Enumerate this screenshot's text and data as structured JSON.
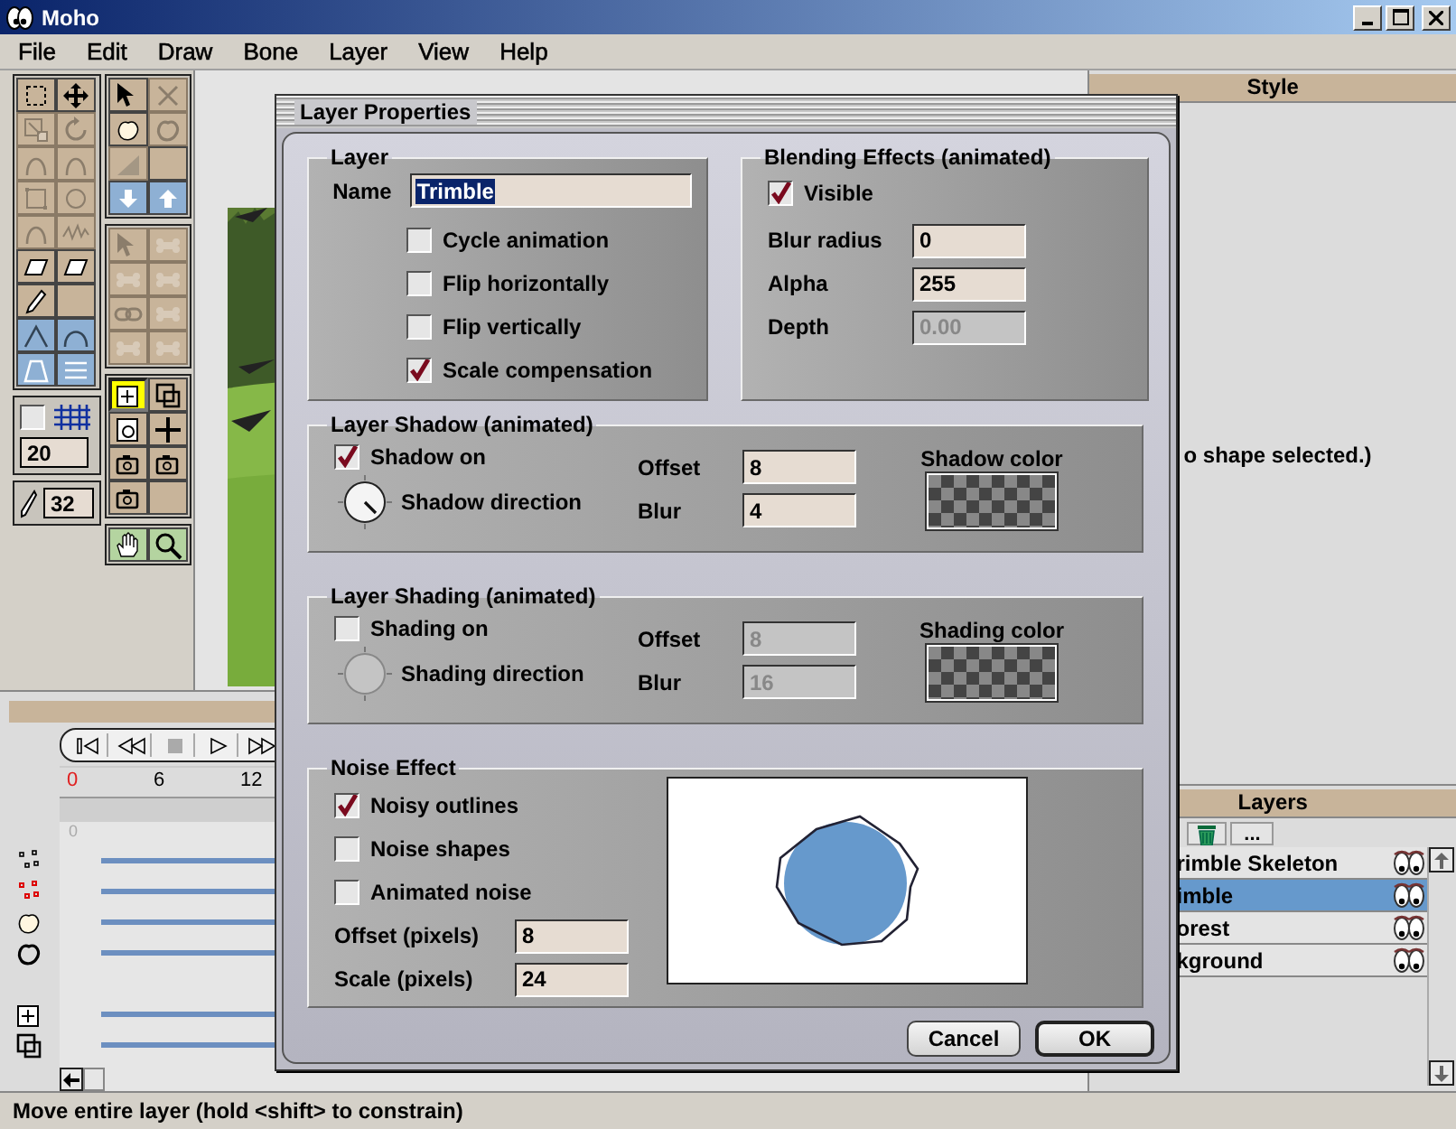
{
  "window": {
    "title": "Moho"
  },
  "menu": [
    "File",
    "Edit",
    "Draw",
    "Bone",
    "Layer",
    "View",
    "Help"
  ],
  "toolbox": {
    "left_tools": [
      {
        "kind": "marquee",
        "disabled": false,
        "selected": false,
        "color": "#c8b49a"
      },
      {
        "kind": "move",
        "disabled": false,
        "selected": false,
        "color": "#c8b49a"
      },
      {
        "kind": "scale",
        "disabled": true,
        "selected": false,
        "color": "#c8b49a"
      },
      {
        "kind": "rotate",
        "disabled": true,
        "selected": false,
        "color": "#c8b49a"
      },
      {
        "kind": "curve",
        "disabled": true,
        "selected": false,
        "color": "#c8b49a"
      },
      {
        "kind": "curve",
        "disabled": true,
        "selected": false,
        "color": "#c8b49a"
      },
      {
        "kind": "rect",
        "disabled": true,
        "selected": false,
        "color": "#c8b49a"
      },
      {
        "kind": "circle",
        "disabled": true,
        "selected": false,
        "color": "#c8b49a"
      },
      {
        "kind": "curve",
        "disabled": true,
        "selected": false,
        "color": "#c8b49a"
      },
      {
        "kind": "wave",
        "disabled": true,
        "selected": false,
        "color": "#c8b49a"
      },
      {
        "kind": "warp",
        "disabled": false,
        "selected": false,
        "color": "#c8b49a"
      },
      {
        "kind": "warp",
        "disabled": false,
        "selected": false,
        "color": "#c8b49a"
      },
      {
        "kind": "pencil",
        "disabled": false,
        "selected": false,
        "color": "#c8b49a"
      },
      {
        "kind": "blank",
        "disabled": false,
        "selected": false,
        "color": "#c8b49a"
      },
      {
        "kind": "peak",
        "disabled": false,
        "selected": false,
        "color": "#8eb0d4"
      },
      {
        "kind": "arch",
        "disabled": false,
        "selected": false,
        "color": "#8eb0d4"
      },
      {
        "kind": "trapezoid",
        "disabled": false,
        "selected": false,
        "color": "#8eb0d4"
      },
      {
        "kind": "lines",
        "disabled": false,
        "selected": false,
        "color": "#8eb0d4"
      }
    ],
    "grid": {
      "checked": false,
      "value": "20"
    },
    "brush": {
      "value": "32"
    },
    "right_groups": [
      {
        "tools": [
          {
            "kind": "pointer",
            "disabled": false,
            "selected": false,
            "color": "#c8b49a"
          },
          {
            "kind": "delete",
            "disabled": true,
            "selected": false,
            "color": "#c8b49a"
          },
          {
            "kind": "fill",
            "disabled": false,
            "selected": false,
            "color": "#c8b49a"
          },
          {
            "kind": "outline",
            "disabled": true,
            "selected": false,
            "color": "#c8b49a"
          },
          {
            "kind": "ramp",
            "disabled": true,
            "selected": false,
            "color": "#c8b49a"
          },
          {
            "kind": "blank",
            "disabled": false,
            "selected": false,
            "color": "#c8b49a"
          },
          {
            "kind": "down",
            "disabled": false,
            "selected": false,
            "color": "#8eb0d4"
          },
          {
            "kind": "up",
            "disabled": false,
            "selected": false,
            "color": "#8eb0d4"
          }
        ]
      },
      {
        "tools": [
          {
            "kind": "pointer",
            "disabled": true,
            "selected": false,
            "color": "#c8b49a"
          },
          {
            "kind": "bone",
            "disabled": true,
            "selected": false,
            "color": "#c8b49a"
          },
          {
            "kind": "bone",
            "disabled": true,
            "selected": false,
            "color": "#c8b49a"
          },
          {
            "kind": "bone",
            "disabled": true,
            "selected": false,
            "color": "#c8b49a"
          },
          {
            "kind": "chain",
            "disabled": true,
            "selected": false,
            "color": "#c8b49a"
          },
          {
            "kind": "bone",
            "disabled": true,
            "selected": false,
            "color": "#c8b49a"
          },
          {
            "kind": "bone",
            "disabled": true,
            "selected": false,
            "color": "#c8b49a"
          },
          {
            "kind": "bone",
            "disabled": true,
            "selected": false,
            "color": "#c8b49a"
          }
        ]
      },
      {
        "tools": [
          {
            "kind": "layermove",
            "disabled": false,
            "selected": true,
            "color": "#ffff00"
          },
          {
            "kind": "layerscale",
            "disabled": false,
            "selected": false,
            "color": "#c8b49a"
          },
          {
            "kind": "layerrotate",
            "disabled": false,
            "selected": false,
            "color": "#c8b49a"
          },
          {
            "kind": "plus",
            "disabled": false,
            "selected": false,
            "color": "#c8b49a"
          },
          {
            "kind": "camera",
            "disabled": false,
            "selected": false,
            "color": "#c8b49a"
          },
          {
            "kind": "camera",
            "disabled": false,
            "selected": false,
            "color": "#c8b49a"
          },
          {
            "kind": "camera",
            "disabled": false,
            "selected": false,
            "color": "#c8b49a"
          },
          {
            "kind": "blank",
            "disabled": false,
            "selected": false,
            "color": "#c8b49a"
          }
        ]
      },
      {
        "tools": [
          {
            "kind": "hand",
            "disabled": false,
            "selected": false,
            "color": "#b4d4a0"
          },
          {
            "kind": "zoom",
            "disabled": false,
            "selected": false,
            "color": "#b4d4a0"
          }
        ]
      }
    ]
  },
  "timeline": {
    "ruler": [
      {
        "label": "0",
        "current": true
      },
      {
        "label": "6",
        "current": false
      },
      {
        "label": "12",
        "current": false
      }
    ],
    "start_frame": "0",
    "channels": [
      {
        "kind": "points"
      },
      {
        "kind": "selection"
      },
      {
        "kind": "fill"
      },
      {
        "kind": "outline"
      },
      {
        "kind": "translation"
      },
      {
        "kind": "scale"
      }
    ]
  },
  "style_panel": {
    "title": "Style",
    "message": "o shape selected.)"
  },
  "layers_panel": {
    "title": "Layers",
    "more_button": "...",
    "layers": [
      {
        "name": "rimble Skeleton",
        "selected": false
      },
      {
        "name": "imble",
        "selected": true
      },
      {
        "name": "orest",
        "selected": false
      },
      {
        "name": "kground",
        "selected": false
      }
    ]
  },
  "status_bar": "Move entire layer (hold <shift> to constrain)",
  "dialog": {
    "title": "Layer Properties",
    "layer": {
      "title": "Layer",
      "name_label": "Name",
      "name_value": "Trimble",
      "name_selected": true,
      "options": [
        {
          "label": "Cycle animation",
          "checked": false
        },
        {
          "label": "Flip horizontally",
          "checked": false
        },
        {
          "label": "Flip vertically",
          "checked": false
        },
        {
          "label": "Scale compensation",
          "checked": true
        }
      ]
    },
    "blending": {
      "title": "Blending Effects (animated)",
      "visible": {
        "label": "Visible",
        "checked": true
      },
      "fields": [
        {
          "label": "Blur radius",
          "value": "0",
          "disabled": false
        },
        {
          "label": "Alpha",
          "value": "255",
          "disabled": false
        },
        {
          "label": "Depth",
          "value": "0.00",
          "disabled": true
        }
      ]
    },
    "shadow": {
      "title": "Layer Shadow (animated)",
      "toggle": {
        "label": "Shadow on",
        "checked": true
      },
      "direction": {
        "label": "Shadow direction",
        "disabled": false
      },
      "fields": [
        {
          "label": "Offset",
          "value": "8",
          "disabled": false
        },
        {
          "label": "Blur",
          "value": "4",
          "disabled": false
        }
      ],
      "color_label": "Shadow color"
    },
    "shading": {
      "title": "Layer Shading (animated)",
      "toggle": {
        "label": "Shading on",
        "checked": false
      },
      "direction": {
        "label": "Shading direction",
        "disabled": true
      },
      "fields": [
        {
          "label": "Offset",
          "value": "8",
          "disabled": true
        },
        {
          "label": "Blur",
          "value": "16",
          "disabled": true
        }
      ],
      "color_label": "Shading color"
    },
    "noise": {
      "title": "Noise Effect",
      "options": [
        {
          "label": "Noisy outlines",
          "checked": true
        },
        {
          "label": "Noise shapes",
          "checked": false
        },
        {
          "label": "Animated noise",
          "checked": false
        }
      ],
      "fields": [
        {
          "label": "Offset (pixels)",
          "value": "8"
        },
        {
          "label": "Scale (pixels)",
          "value": "24"
        }
      ]
    },
    "buttons": [
      {
        "label": "Cancel",
        "default": false
      },
      {
        "label": "OK",
        "default": true
      }
    ]
  }
}
